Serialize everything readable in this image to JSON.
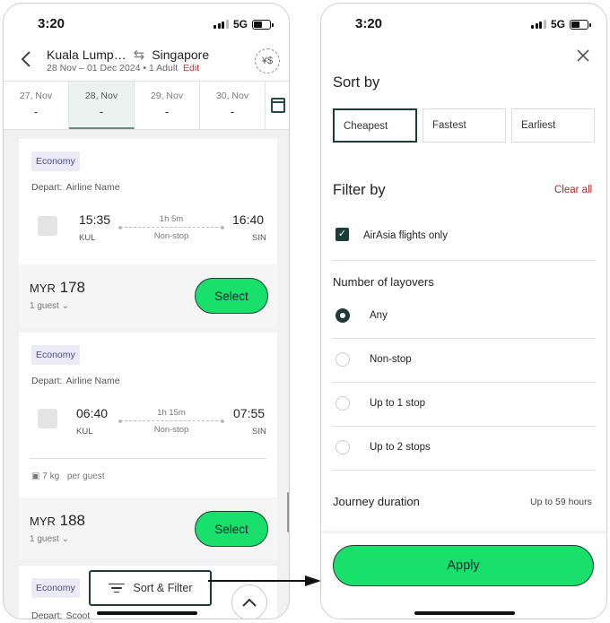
{
  "left": {
    "status": {
      "time": "3:20",
      "network": "5G"
    },
    "header": {
      "origin": "Kuala Lump…",
      "destination": "Singapore",
      "trip_info": "28 Nov – 01 Dec 2024 • 1 Adult",
      "edit_label": "Edit",
      "currency_icon": "currency-exchange-icon"
    },
    "dates": [
      {
        "date": "27, Nov",
        "price": "-"
      },
      {
        "date": "28, Nov",
        "price": "-",
        "active": true
      },
      {
        "date": "29, Nov",
        "price": "-"
      },
      {
        "date": "30, Nov",
        "price": "-"
      }
    ],
    "flights": [
      {
        "class": "Economy",
        "depart_label": "Depart:",
        "airline": "Airline Name",
        "dep_time": "15:35",
        "dep_code": "KUL",
        "arr_time": "16:40",
        "arr_code": "SIN",
        "duration": "1h 5m",
        "stops": "Non-stop",
        "currency": "MYR",
        "price": "178",
        "guests": "1 guest",
        "select_label": "Select"
      },
      {
        "class": "Economy",
        "depart_label": "Depart:",
        "airline": "Airline Name",
        "dep_time": "06:40",
        "dep_code": "KUL",
        "arr_time": "07:55",
        "arr_code": "SIN",
        "duration": "1h 15m",
        "stops": "Non-stop",
        "baggage": "7 kg",
        "baggage_note": "per guest",
        "currency": "MYR",
        "price": "188",
        "guests": "1 guest",
        "select_label": "Select"
      },
      {
        "class": "Economy",
        "depart_label": "Depart:",
        "airline": "Scoot"
      }
    ],
    "sort_filter_label": "Sort & Filter"
  },
  "right": {
    "status": {
      "time": "3:20",
      "network": "5G"
    },
    "sort_title": "Sort by",
    "sort_options": [
      {
        "label": "Cheapest",
        "active": true
      },
      {
        "label": "Fastest"
      },
      {
        "label": "Earliest"
      }
    ],
    "filter_title": "Filter by",
    "clear_all_label": "Clear all",
    "airasia_only_label": "AirAsia flights only",
    "airasia_only_checked": true,
    "layovers_title": "Number of layovers",
    "layover_options": [
      {
        "label": "Any",
        "selected": true
      },
      {
        "label": "Non-stop"
      },
      {
        "label": "Up to 1 stop"
      },
      {
        "label": "Up to 2 stops"
      }
    ],
    "duration_title": "Journey duration",
    "duration_value": "Up to 59 hours",
    "apply_label": "Apply"
  },
  "colors": {
    "accent_green": "#19e06a",
    "dark_teal": "#1d3b37",
    "edit_red": "#c0392b",
    "clear_all_red": "#b3262b",
    "badge_bg": "#eceaf6"
  }
}
